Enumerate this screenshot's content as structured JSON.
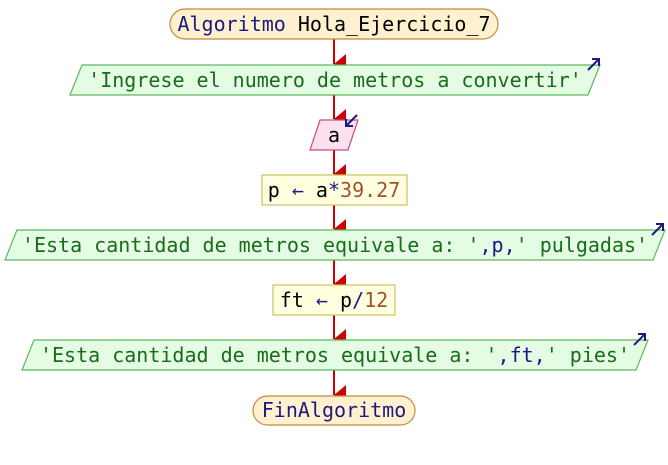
{
  "diagram": {
    "start": {
      "keyword": "Algoritmo",
      "name": "Hola_Ejercicio_7"
    },
    "steps": [
      {
        "type": "output",
        "parts": [
          {
            "cls": "str",
            "text": "'Ingrese el numero de metros a convertir'"
          }
        ]
      },
      {
        "type": "input",
        "parts": [
          {
            "cls": "id",
            "text": "a"
          }
        ]
      },
      {
        "type": "assign",
        "parts": [
          {
            "cls": "id",
            "text": "p "
          },
          {
            "cls": "op",
            "text": "←"
          },
          {
            "cls": "id",
            "text": " a"
          },
          {
            "cls": "op",
            "text": "*"
          },
          {
            "cls": "num",
            "text": "39.27"
          }
        ]
      },
      {
        "type": "output",
        "parts": [
          {
            "cls": "str",
            "text": "'Esta cantidad de metros equivale a: '"
          },
          {
            "cls": "op",
            "text": ","
          },
          {
            "cls": "kw",
            "text": "p"
          },
          {
            "cls": "op",
            "text": ","
          },
          {
            "cls": "str",
            "text": "' pulgadas'"
          }
        ]
      },
      {
        "type": "assign",
        "parts": [
          {
            "cls": "id",
            "text": "ft "
          },
          {
            "cls": "op",
            "text": "←"
          },
          {
            "cls": "id",
            "text": " p"
          },
          {
            "cls": "op",
            "text": "/"
          },
          {
            "cls": "num",
            "text": "12"
          }
        ]
      },
      {
        "type": "output",
        "parts": [
          {
            "cls": "str",
            "text": "'Esta cantidad de metros equivale a: '"
          },
          {
            "cls": "op",
            "text": ","
          },
          {
            "cls": "kw",
            "text": "ft"
          },
          {
            "cls": "op",
            "text": ","
          },
          {
            "cls": "str",
            "text": "' pies'"
          }
        ]
      }
    ],
    "end": {
      "keyword": "FinAlgoritmo"
    },
    "colors": {
      "arrow": "#cc0000",
      "terminal_fill": "#fff0d0",
      "terminal_stroke": "#c08a3a",
      "output_fill": "#e4fbe4",
      "output_stroke": "#5cb85c",
      "input_fill": "#fde0ef",
      "input_stroke": "#c05080",
      "assign_fill": "#ffffe0",
      "assign_stroke": "#c8c060",
      "io_icon": "#1a1a80"
    }
  }
}
